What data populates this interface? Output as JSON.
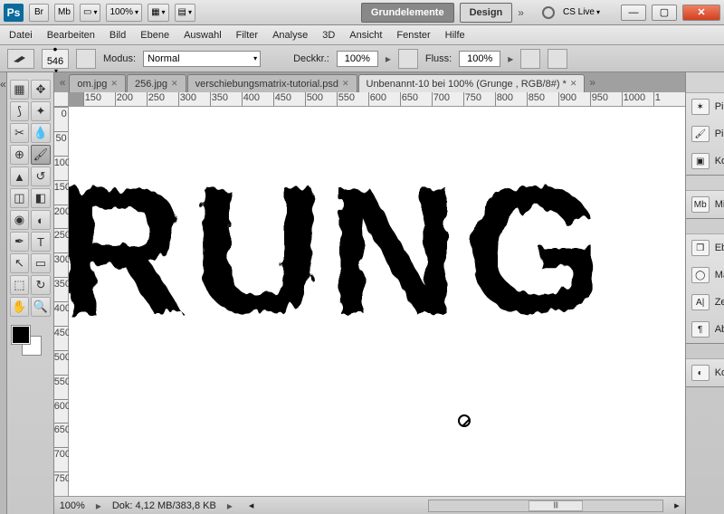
{
  "title": {
    "zoom": "100%",
    "workspaces": [
      "Grundelemente",
      "Design"
    ],
    "cslive": "CS Live"
  },
  "menu": [
    "Datei",
    "Bearbeiten",
    "Bild",
    "Ebene",
    "Auswahl",
    "Filter",
    "Analyse",
    "3D",
    "Ansicht",
    "Fenster",
    "Hilfe"
  ],
  "opt": {
    "brush_size": "546",
    "mode_label": "Modus:",
    "mode_value": "Normal",
    "opacity_label": "Deckkr.:",
    "opacity_value": "100%",
    "flow_label": "Fluss:",
    "flow_value": "100%"
  },
  "tabs": [
    {
      "label": "om.jpg",
      "active": false
    },
    {
      "label": "256.jpg",
      "active": false
    },
    {
      "label": "verschiebungsmatrix-tutorial.psd",
      "active": false
    },
    {
      "label": "Unbenannt-10 bei 100% (Grunge  , RGB/8#) *",
      "active": true
    }
  ],
  "ruler_h": [
    "150",
    "200",
    "250",
    "300",
    "350",
    "400",
    "450",
    "500",
    "550",
    "600",
    "650",
    "700",
    "750",
    "800",
    "850",
    "900",
    "950",
    "1000",
    "1"
  ],
  "ruler_v": [
    "0",
    "50",
    "100",
    "150",
    "200",
    "250",
    "300",
    "350",
    "400",
    "450",
    "500",
    "550",
    "600",
    "650",
    "700",
    "750"
  ],
  "canvas_text": "RUNG",
  "status": {
    "zoom": "100%",
    "dok": "Dok: 4,12 MB/383,8 KB",
    "thumb": "|||"
  },
  "panels": {
    "group1": [
      "Pinsel...",
      "Pinsel",
      "Kopie..."
    ],
    "group2": [
      "Mini ..."
    ],
    "group3": [
      "Ebenen",
      "Masken",
      "Zeichen",
      "Absatz"
    ],
    "group4": [
      "Korre..."
    ]
  },
  "toolbox": [
    [
      "move",
      "marquee"
    ],
    [
      "lasso",
      "wand"
    ],
    [
      "crop",
      "eyedrop"
    ],
    [
      "heal",
      "brush"
    ],
    [
      "stamp",
      "history"
    ],
    [
      "eraser",
      "gradient"
    ],
    [
      "blur",
      "dodge"
    ],
    [
      "pen",
      "type"
    ],
    [
      "path",
      "shape"
    ],
    [
      "hand3d",
      "rot3d"
    ],
    [
      "hand",
      "zoom"
    ]
  ],
  "icons": {
    "br": "Br",
    "mb": "Mb",
    "screen": "▭",
    "grid": "▦",
    "doc": "▤"
  }
}
